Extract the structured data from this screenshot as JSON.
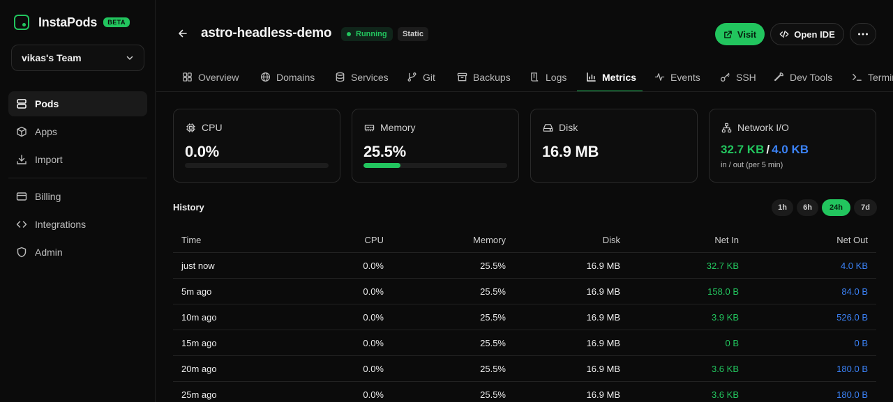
{
  "brand": {
    "name": "InstaPods",
    "badge": "BETA",
    "accent": "#22c55e"
  },
  "team": {
    "name": "vikas's Team"
  },
  "nav": {
    "primary": [
      {
        "label": "Pods",
        "icon": "server-icon",
        "active": true
      },
      {
        "label": "Apps",
        "icon": "box-icon"
      },
      {
        "label": "Import",
        "icon": "download-icon"
      }
    ],
    "secondary": [
      {
        "label": "Billing",
        "icon": "credit-card-icon"
      },
      {
        "label": "Integrations",
        "icon": "code-icon"
      },
      {
        "label": "Admin",
        "icon": "shield-icon"
      }
    ]
  },
  "header": {
    "title": "astro-headless-demo",
    "status": "Running",
    "type": "Static",
    "visit_label": "Visit",
    "ide_label": "Open IDE"
  },
  "tabs": [
    {
      "label": "Overview",
      "icon": "grid-icon"
    },
    {
      "label": "Domains",
      "icon": "globe-icon"
    },
    {
      "label": "Services",
      "icon": "database-icon"
    },
    {
      "label": "Git",
      "icon": "git-branch-icon"
    },
    {
      "label": "Backups",
      "icon": "archive-icon"
    },
    {
      "label": "Logs",
      "icon": "scroll-icon"
    },
    {
      "label": "Metrics",
      "icon": "bar-chart-icon",
      "active": true
    },
    {
      "label": "Events",
      "icon": "activity-icon"
    },
    {
      "label": "SSH",
      "icon": "key-icon"
    },
    {
      "label": "Dev Tools",
      "icon": "wrench-icon"
    },
    {
      "label": "Terminal",
      "icon": "terminal-icon"
    }
  ],
  "stats": {
    "cpu": {
      "label": "CPU",
      "value": "0.0%",
      "percent": 0
    },
    "memory": {
      "label": "Memory",
      "value": "25.5%",
      "percent": 25.5
    },
    "disk": {
      "label": "Disk",
      "value": "16.9 MB"
    },
    "network": {
      "label": "Network I/O",
      "in": "32.7 KB",
      "sep": "/",
      "out": "4.0 KB",
      "sub": "in / out (per 5 min)",
      "in_color": "#22c55e",
      "out_color": "#3b82f6"
    }
  },
  "history": {
    "title": "History",
    "ranges": [
      "1h",
      "6h",
      "24h",
      "7d"
    ],
    "active_range": "24h",
    "columns": [
      "Time",
      "CPU",
      "Memory",
      "Disk",
      "Net In",
      "Net Out"
    ],
    "rows": [
      [
        "just now",
        "0.0%",
        "25.5%",
        "16.9 MB",
        "32.7 KB",
        "4.0 KB"
      ],
      [
        "5m ago",
        "0.0%",
        "25.5%",
        "16.9 MB",
        "158.0 B",
        "84.0 B"
      ],
      [
        "10m ago",
        "0.0%",
        "25.5%",
        "16.9 MB",
        "3.9 KB",
        "526.0 B"
      ],
      [
        "15m ago",
        "0.0%",
        "25.5%",
        "16.9 MB",
        "0 B",
        "0 B"
      ],
      [
        "20m ago",
        "0.0%",
        "25.5%",
        "16.9 MB",
        "3.6 KB",
        "180.0 B"
      ],
      [
        "25m ago",
        "0.0%",
        "25.5%",
        "16.9 MB",
        "3.6 KB",
        "180.0 B"
      ]
    ]
  }
}
